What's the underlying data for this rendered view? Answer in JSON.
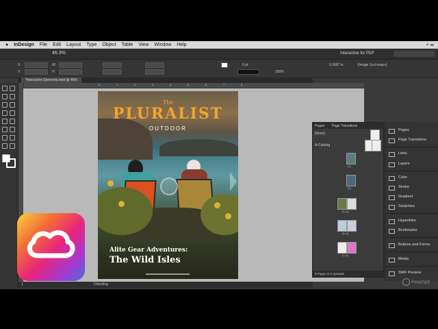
{
  "menubar": {
    "app_name": "InDesign",
    "items": [
      "File",
      "Edit",
      "Layout",
      "Type",
      "Object",
      "Table",
      "View",
      "Window",
      "Help"
    ]
  },
  "appbar": {
    "zoom": "46.3%",
    "workspace": "Interactive for PDF"
  },
  "control_panel": {
    "labels": [
      "X:",
      "Y:",
      "W:",
      "H:"
    ],
    "stroke_weight": "0 pt",
    "scale": "100%",
    "ref_value": "0.1667 in",
    "object_style": "[Image 1col wrap+]"
  },
  "document_tab": {
    "title": "*Interactive Elements.indd @ 46%"
  },
  "ruler": {
    "ticks": [
      "0",
      "1",
      "2",
      "3",
      "4",
      "5",
      "6",
      "7",
      "8"
    ]
  },
  "page_content": {
    "the": "The",
    "logo": "PLURALIST",
    "subtitle": "OUTDOOR",
    "tagline": "Alite Gear Adventures:",
    "headline": "The Wild Isles"
  },
  "pages_panel": {
    "tab_pages": "Pages",
    "tab_transitions": "Page Transitions",
    "none_label": "[None]",
    "master_label": "A-Catalog",
    "page_labels": [
      "[1]",
      "[2]",
      "[3–4]",
      "[5–6]",
      "[7–8]"
    ],
    "footer": "8 Pages in 5 Spreads"
  },
  "side_panels": {
    "items": [
      "Pages",
      "Page Transitions",
      "Links",
      "Layers",
      "Color",
      "Stroke",
      "Gradient",
      "Swatches",
      "Hyperlinks",
      "Bookmarks",
      "Buttons and Forms",
      "Media",
      "SWF Preview"
    ]
  },
  "status_bar": {
    "page": "1",
    "preflight": "Checking"
  },
  "watermark": {
    "brand": "Peachpit"
  },
  "colors": {
    "logo_orange": "#f0a432",
    "paste_board": "#b9b9b9",
    "ui_dark": "#3a3a3a"
  }
}
